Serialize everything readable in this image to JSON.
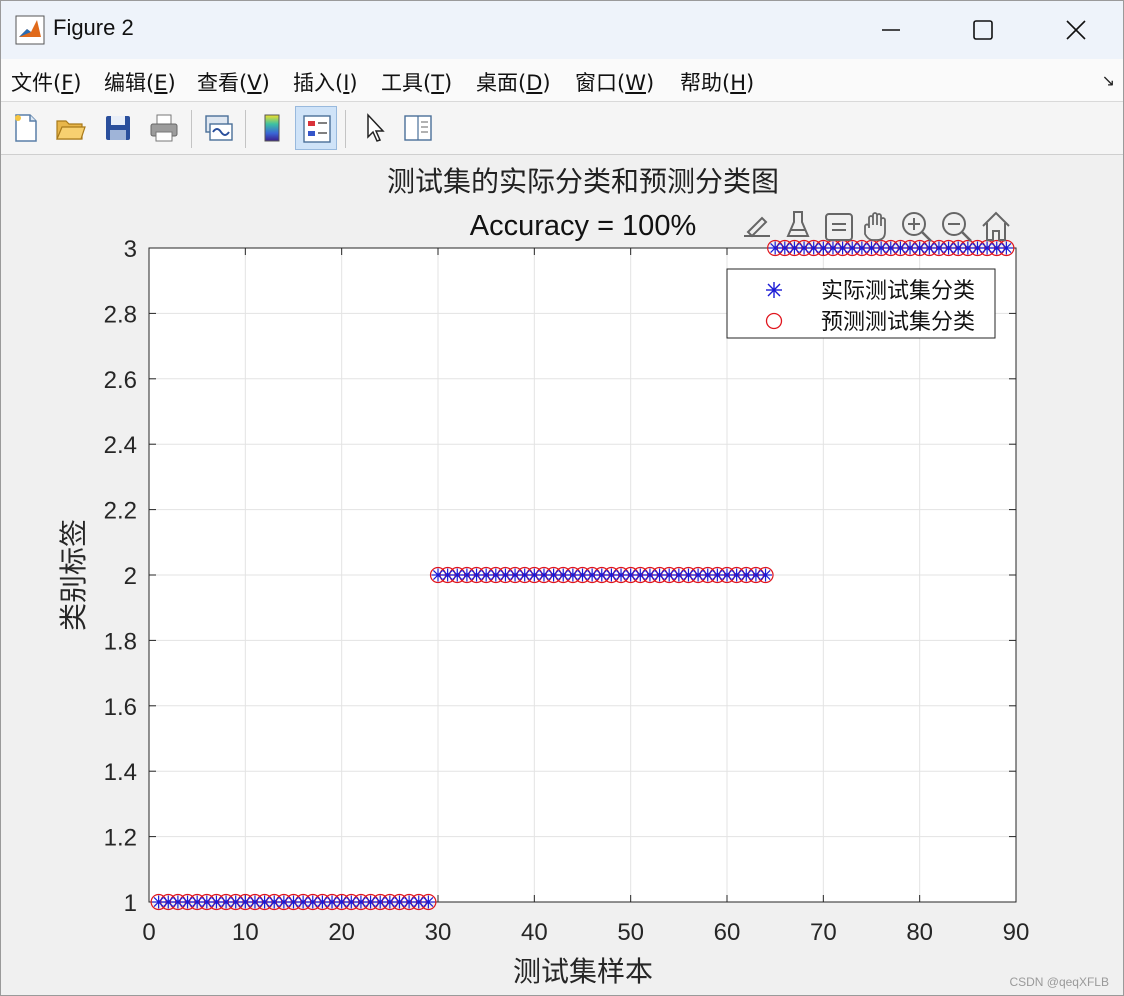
{
  "window": {
    "title": "Figure 2",
    "controls": [
      "minimize",
      "maximize",
      "close"
    ]
  },
  "menu": {
    "items": [
      {
        "text": "文件(",
        "key": "F",
        "end": ")"
      },
      {
        "text": "编辑(",
        "key": "E",
        "end": ")"
      },
      {
        "text": "查看(",
        "key": "V",
        "end": ")"
      },
      {
        "text": "插入(",
        "key": "I",
        "end": ")"
      },
      {
        "text": "工具(",
        "key": "T",
        "end": ")"
      },
      {
        "text": "桌面(",
        "key": "D",
        "end": ")"
      },
      {
        "text": "窗口(",
        "key": "W",
        "end": ")"
      },
      {
        "text": "帮助(",
        "key": "H",
        "end": ")"
      }
    ],
    "dock_glyph": "↘"
  },
  "toolbar": {
    "buttons": [
      "new-figure-icon",
      "open-folder-icon",
      "save-icon",
      "print-icon",
      "link-icon",
      "colorbar-icon",
      "legend-icon",
      "pointer-icon",
      "property-panel-icon"
    ],
    "active": "legend-icon"
  },
  "axes_toolbar": {
    "buttons": [
      "brush-edit-icon",
      "data-brush-icon",
      "data-tips-icon",
      "pan-hand-icon",
      "zoom-in-icon",
      "zoom-out-icon",
      "home-icon"
    ]
  },
  "chart_data": {
    "type": "scatter",
    "title": "测试集的实际分类和预测分类图",
    "subtitle": "Accuracy = 100%",
    "xlabel": "测试集样本",
    "ylabel": "类别标签",
    "xlim": [
      0,
      90
    ],
    "ylim": [
      1,
      3
    ],
    "xticks": [
      0,
      10,
      20,
      30,
      40,
      50,
      60,
      70,
      80,
      90
    ],
    "yticks": [
      1,
      1.2,
      1.4,
      1.6,
      1.8,
      2,
      2.2,
      2.4,
      2.6,
      2.8,
      3
    ],
    "grid": true,
    "legend_position": "top-right",
    "series": [
      {
        "name": "实际测试集分类",
        "marker": "asterisk",
        "color": "#1a1ad6",
        "segments": [
          {
            "x_start": 1,
            "x_end": 29,
            "y": 1
          },
          {
            "x_start": 30,
            "x_end": 64,
            "y": 2
          },
          {
            "x_start": 65,
            "x_end": 89,
            "y": 3
          }
        ]
      },
      {
        "name": "预测测试集分类",
        "marker": "circle",
        "color": "#e0161e",
        "segments": [
          {
            "x_start": 1,
            "x_end": 29,
            "y": 1
          },
          {
            "x_start": 30,
            "x_end": 64,
            "y": 2
          },
          {
            "x_start": 65,
            "x_end": 89,
            "y": 3
          }
        ]
      }
    ]
  },
  "watermark": "CSDN @qeqXFLB"
}
